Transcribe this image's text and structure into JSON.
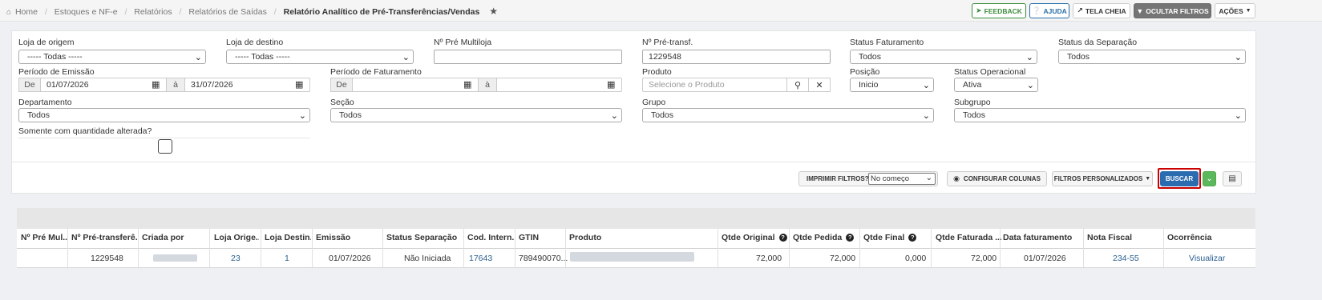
{
  "breadcrumb": {
    "items": [
      "Home",
      "Estoques e NF-e",
      "Relatórios",
      "Relatórios de Saídas"
    ],
    "current": "Relatório Analítico de Pré-Transferências/Vendas"
  },
  "top_buttons": {
    "feedback": "FEEDBACK",
    "ajuda": "AJUDA",
    "tela_cheia": "TELA CHEIA",
    "ocultar_filtros": "OCULTAR FILTROS",
    "acoes": "AÇÕES"
  },
  "filters": {
    "loja_origem": {
      "label": "Loja de origem",
      "value": "----- Todas -----"
    },
    "loja_destino": {
      "label": "Loja de destino",
      "value": "----- Todas -----"
    },
    "pre_multiloja": {
      "label": "Nº Pré Multiloja",
      "value": ""
    },
    "pre_transf": {
      "label": "Nº Pré-transf.",
      "value": "1229548"
    },
    "status_faturamento": {
      "label": "Status Faturamento",
      "value": "Todos"
    },
    "status_separacao": {
      "label": "Status da Separação",
      "value": "Todos"
    },
    "periodo_emissao": {
      "label": "Período de Emissão",
      "de": "De",
      "a": "à",
      "start": "01/07/2026",
      "end": "31/07/2026"
    },
    "periodo_faturamento": {
      "label": "Período de Faturamento",
      "de": "De",
      "a": "à",
      "start": "",
      "end": ""
    },
    "produto": {
      "label": "Produto",
      "placeholder": "Selecione o Produto"
    },
    "posicao": {
      "label": "Posição",
      "value": "Inicio"
    },
    "status_operacional": {
      "label": "Status Operacional",
      "value": "Ativa"
    },
    "departamento": {
      "label": "Departamento",
      "value": "Todos"
    },
    "secao": {
      "label": "Seção",
      "value": "Todos"
    },
    "grupo": {
      "label": "Grupo",
      "value": "Todos"
    },
    "subgrupo": {
      "label": "Subgrupo",
      "value": "Todos"
    },
    "somente_alterada": {
      "label": "Somente com quantidade alterada?",
      "checked": false
    }
  },
  "actions": {
    "imprimir_filtros": "IMPRIMIR FILTROS?",
    "imprimir_option": "No começo",
    "configurar_colunas": "CONFIGURAR COLUNAS",
    "filtros_personalizados": "FILTROS PERSONALIZADOS",
    "buscar": "BUSCAR"
  },
  "table": {
    "columns": [
      "Nº Pré Mul...",
      "Nº Pré-transferê...",
      "Criada por",
      "Loja Orige...",
      "Loja Destin...",
      "Emissão",
      "Status Separação",
      "Cod. Intern...",
      "GTIN",
      "Produto",
      "Qtde Original",
      "Qtde Pedida",
      "Qtde Final",
      "Qtde Faturada ...",
      "Data faturamento",
      "Nota Fiscal",
      "Ocorrência"
    ],
    "rows": [
      {
        "pre_mul": "",
        "pre_transf": "1229548",
        "criada_por": "",
        "loja_origem": "23",
        "loja_destino": "1",
        "emissao": "01/07/2026",
        "status_separacao": "Não Iniciada",
        "cod_interno": "17643",
        "gtin": "789490070...",
        "produto": "",
        "qtde_original": "72,000",
        "qtde_pedida": "72,000",
        "qtde_final": "0,000",
        "qtde_faturada": "72,000",
        "data_faturamento": "01/07/2026",
        "nota_fiscal": "234-55",
        "ocorrencia": "Visualizar"
      }
    ]
  },
  "colors": {
    "feedback": "#3c8d3c",
    "ajuda": "#2a6fa8",
    "ocultar_bg": "#757575",
    "buscar_bg": "#2b6cb0",
    "buscar_border": "#cc0000",
    "green_btn": "#5cb85c",
    "link": "#2a5f8f"
  }
}
